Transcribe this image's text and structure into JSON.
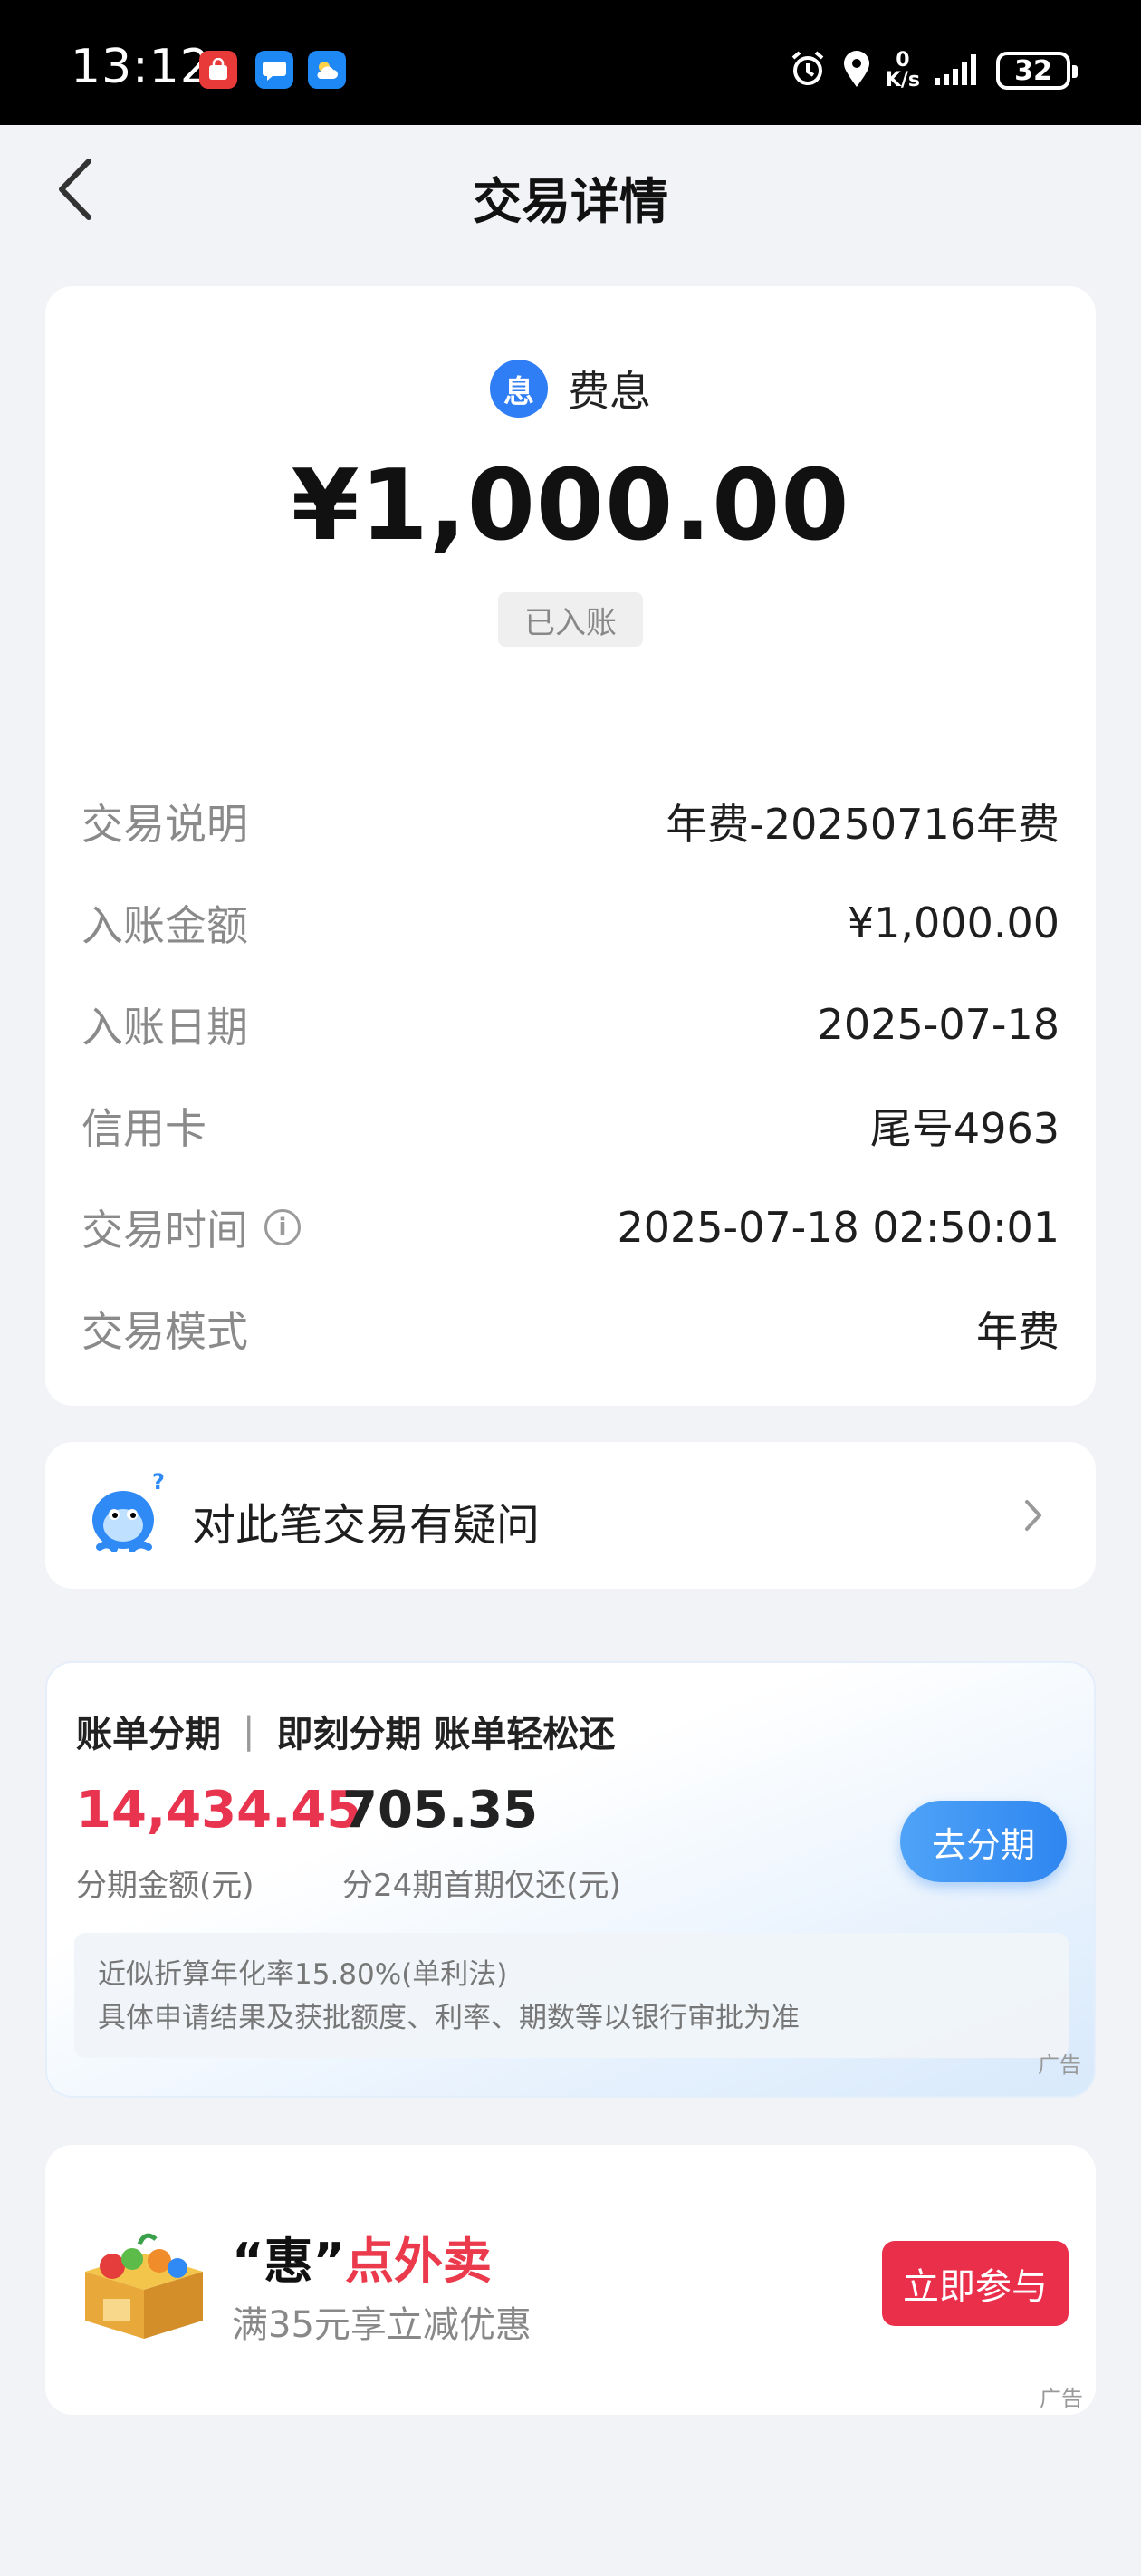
{
  "status_bar": {
    "time": "13:12",
    "speed_value": "0",
    "speed_unit": "K/s",
    "battery": "32"
  },
  "header": {
    "title": "交易详情"
  },
  "transaction": {
    "type_badge": "息",
    "type_label": "费息",
    "amount": "¥1,000.00",
    "status": "已入账",
    "details": [
      {
        "label": "交易说明",
        "value": "年费-20250716年费"
      },
      {
        "label": "入账金额",
        "value": "¥1,000.00"
      },
      {
        "label": "入账日期",
        "value": "2025-07-18"
      },
      {
        "label": "信用卡",
        "value": "尾号4963"
      },
      {
        "label": "交易时间",
        "value": "2025-07-18 02:50:01"
      },
      {
        "label": "交易模式",
        "value": "年费"
      }
    ]
  },
  "dispute": {
    "text": "对此笔交易有疑问"
  },
  "installment": {
    "title_left": "账单分期",
    "separator": "|",
    "title_right": "即刻分期 账单轻松还",
    "amount": "14,434.45",
    "amount_label": "分期金额(元)",
    "first_payment": "705.35",
    "first_payment_label": "分24期首期仅还(元)",
    "button": "去分期",
    "note_line1": "近似折算年化率15.80%(单利法)",
    "note_line2": "具体申请结果及获批额度、利率、期数等以银行审批为准",
    "ad_tag": "广告"
  },
  "promo": {
    "title_prefix": "“惠”",
    "title_highlight": "点外卖",
    "subtitle": "满35元享立减优惠",
    "button": "立即参与",
    "ad_tag": "广告"
  },
  "colors": {
    "accent_blue": "#2f7ef6",
    "accent_red": "#e8344e",
    "background": "#f2f3f6"
  }
}
